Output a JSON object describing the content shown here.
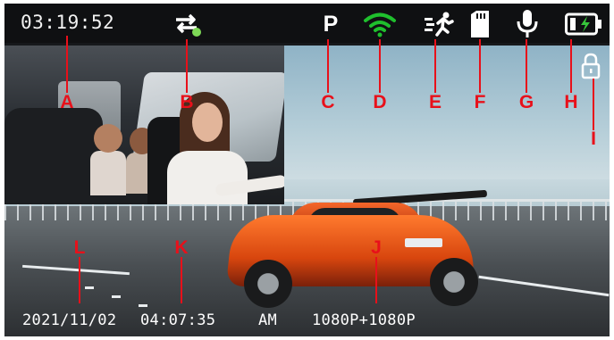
{
  "status_bar": {
    "clock": "03:19:52",
    "parking_mode_letter": "P",
    "icons": [
      "loop-recording-icon",
      "parking-mode-icon",
      "wifi-icon",
      "motion-detection-icon",
      "sd-card-icon",
      "microphone-icon",
      "battery-charging-icon",
      "lock-icon"
    ]
  },
  "colors": {
    "wifi": "#1fbf2d",
    "label_red": "#e8101a",
    "battery_bolt": "#36c53a",
    "loop_dot": "#7ed957"
  },
  "callouts": {
    "A": "A",
    "B": "B",
    "C": "C",
    "D": "D",
    "E": "E",
    "F": "F",
    "G": "G",
    "H": "H",
    "I": "I",
    "J": "J",
    "K": "K",
    "L": "L"
  },
  "footer": {
    "date": "2021/11/02",
    "time": "04:07:35",
    "meridiem": "AM",
    "resolution": "1080P+1080P"
  }
}
